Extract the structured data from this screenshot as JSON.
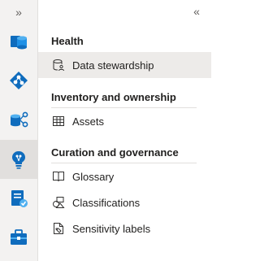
{
  "rail": {
    "expand_glyph": "»",
    "buttons": [
      {
        "name": "data-map-icon"
      },
      {
        "name": "data-catalog-icon"
      },
      {
        "name": "data-estate-icon"
      },
      {
        "name": "data-insights-icon"
      },
      {
        "name": "data-policy-icon"
      },
      {
        "name": "management-icon"
      }
    ],
    "selected_index": 3
  },
  "panel": {
    "collapse_glyph": "«",
    "sections": [
      {
        "title": "Health",
        "items": [
          {
            "label": "Data stewardship",
            "icon": "data-stewardship-icon",
            "selected": true
          }
        ]
      },
      {
        "title": "Inventory and ownership",
        "items": [
          {
            "label": "Assets",
            "icon": "assets-table-icon",
            "selected": false
          }
        ]
      },
      {
        "title": "Curation and governance",
        "items": [
          {
            "label": "Glossary",
            "icon": "glossary-book-icon",
            "selected": false
          },
          {
            "label": "Classifications",
            "icon": "classifications-icon",
            "selected": false
          },
          {
            "label": "Sensitivity labels",
            "icon": "sensitivity-labels-icon",
            "selected": false
          }
        ]
      }
    ]
  },
  "colors": {
    "rail_bg": "#f3f2f1",
    "selected_rail_bg": "#e1dfdd",
    "selected_item_bg": "#edebe9",
    "accent_blue": "#0078d4"
  }
}
